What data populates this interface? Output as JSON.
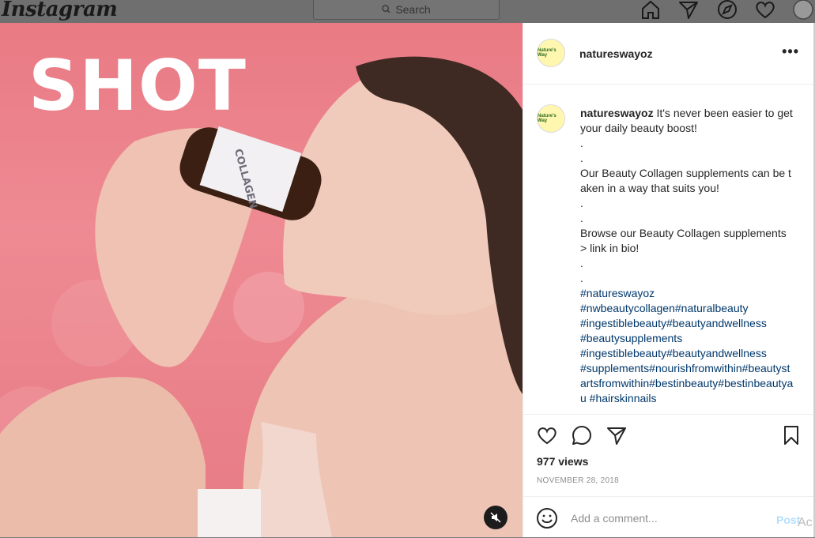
{
  "nav": {
    "logo": "Instagram",
    "search_placeholder": "Search",
    "icons": [
      "home-icon",
      "direct-icon",
      "explore-icon",
      "heart-icon",
      "profile-avatar"
    ]
  },
  "media": {
    "overlay_text": "SHOT",
    "mute_icon": "speaker-muted-icon"
  },
  "post": {
    "username": "natureswayoz",
    "avatar_text": "Nature's Way",
    "more_label": "•••",
    "caption_user": "natureswayoz",
    "caption_text": " It's never been easier to get your daily beauty boost!\n.\n.\nOur Beauty Collagen supplements can be taken in a way that suits you!\n.\n.\nBrowse our Beauty Collagen supplements > link in bio!\n.\n.\n",
    "hashtags": "#natureswayoz\n#nwbeautycollagen#naturalbeauty\n#ingestiblebeauty#beautyandwellness\n#beautysupplements\n#ingestiblebeauty#beautyandwellness\n#supplements#nourishfromwithin#beautystartsfromwithin#bestinbeauty#bestinbeautyau #hairskinnails",
    "views": "977 views",
    "date": "NOVEMBER 28, 2018",
    "comment_placeholder": "Add a comment...",
    "post_label": "Post",
    "activate_text": "Ac"
  },
  "colors": {
    "hashtag": "#00376b",
    "post_button": "#b2dffc",
    "media_bg": "#ee8a93"
  }
}
